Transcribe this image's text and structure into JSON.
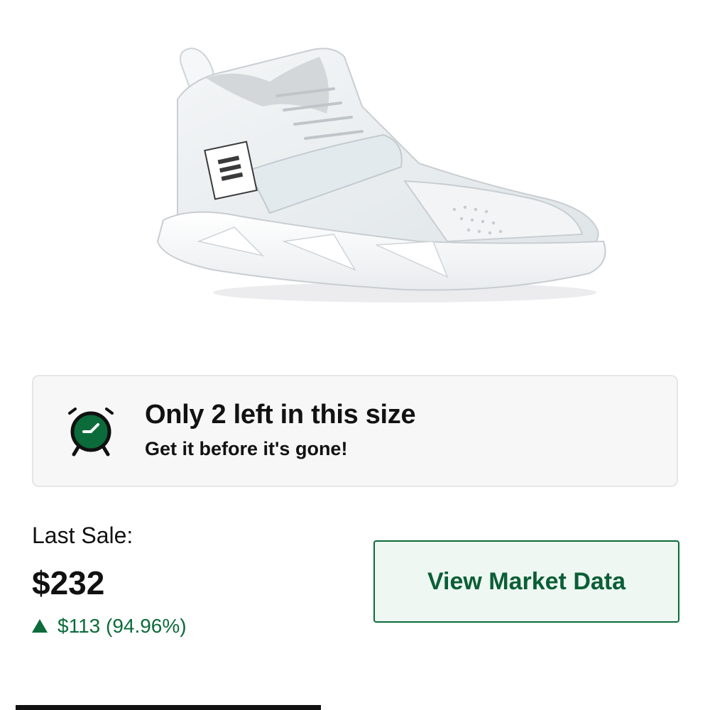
{
  "product": {
    "image_icon": "white-basketball-sneaker-image"
  },
  "scarcity": {
    "icon": "alarm-clock-icon",
    "title": "Only 2 left in this size",
    "subtitle": "Get it before it's gone!"
  },
  "last_sale": {
    "label": "Last Sale:",
    "price": "$232",
    "change": "$113 (94.96%)",
    "change_direction": "up",
    "change_color": "#0b6b3a"
  },
  "actions": {
    "market_button_label": "View Market Data"
  },
  "colors": {
    "accent": "#0b6b3a",
    "card_background": "#f7f7f7"
  }
}
